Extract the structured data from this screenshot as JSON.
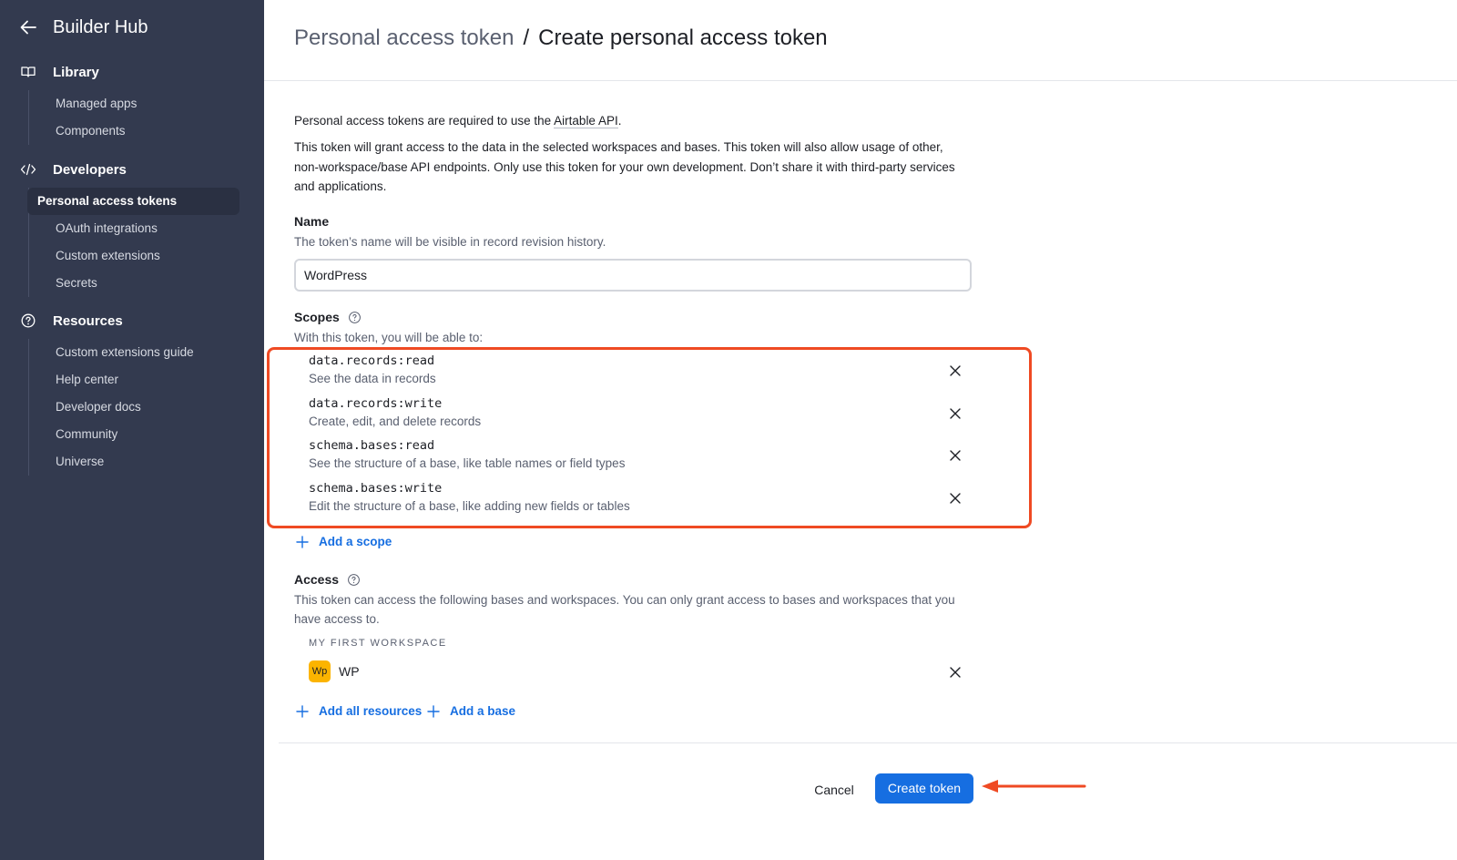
{
  "sidebar": {
    "title": "Builder Hub",
    "back_icon": "arrow-left-icon",
    "sections": [
      {
        "label": "Library",
        "icon": "book-icon",
        "items": [
          {
            "label": "Managed apps",
            "active": false
          },
          {
            "label": "Components",
            "active": false
          }
        ]
      },
      {
        "label": "Developers",
        "icon": "code-icon",
        "items": [
          {
            "label": "Personal access tokens",
            "active": true
          },
          {
            "label": "OAuth integrations",
            "active": false
          },
          {
            "label": "Custom extensions",
            "active": false
          },
          {
            "label": "Secrets",
            "active": false
          }
        ]
      },
      {
        "label": "Resources",
        "icon": "help-circle-icon",
        "items": [
          {
            "label": "Custom extensions guide",
            "active": false
          },
          {
            "label": "Help center",
            "active": false
          },
          {
            "label": "Developer docs",
            "active": false
          },
          {
            "label": "Community",
            "active": false
          },
          {
            "label": "Universe",
            "active": false
          }
        ]
      }
    ]
  },
  "header": {
    "breadcrumb_parent": "Personal access token",
    "breadcrumb_separator": "/",
    "breadcrumb_current": "Create personal access token"
  },
  "intro": {
    "line1_prefix": "Personal access tokens are required to use the ",
    "line1_link": "Airtable API",
    "line1_suffix": ".",
    "paragraph": "This token will grant access to the data in the selected workspaces and bases. This token will also allow usage of other, non-workspace/base API endpoints. Only use this token for your own development. Don’t share it with third-party services and applications."
  },
  "name_field": {
    "label": "Name",
    "help": "The token’s name will be visible in record revision history.",
    "value": "WordPress"
  },
  "scopes": {
    "label": "Scopes",
    "help": "With this token, you will be able to:",
    "items": [
      {
        "code": "data.records:read",
        "description": "See the data in records"
      },
      {
        "code": "data.records:write",
        "description": "Create, edit, and delete records"
      },
      {
        "code": "schema.bases:read",
        "description": "See the structure of a base, like table names or field types"
      },
      {
        "code": "schema.bases:write",
        "description": "Edit the structure of a base, like adding new fields or tables"
      }
    ],
    "add_label": "Add a scope"
  },
  "access": {
    "label": "Access",
    "help": "This token can access the following bases and workspaces. You can only grant access to bases and workspaces that you have access to.",
    "workspace": "MY FIRST WORKSPACE",
    "base_badge": "Wp",
    "base_name": "WP",
    "add_all_label": "Add all resources",
    "add_base_label": "Add a base"
  },
  "footer": {
    "cancel_label": "Cancel",
    "create_label": "Create token"
  },
  "colors": {
    "sidebar_bg": "#333a4f",
    "primary": "#166ee1",
    "highlight": "#ef4a23",
    "base_badge": "#fcb400"
  }
}
